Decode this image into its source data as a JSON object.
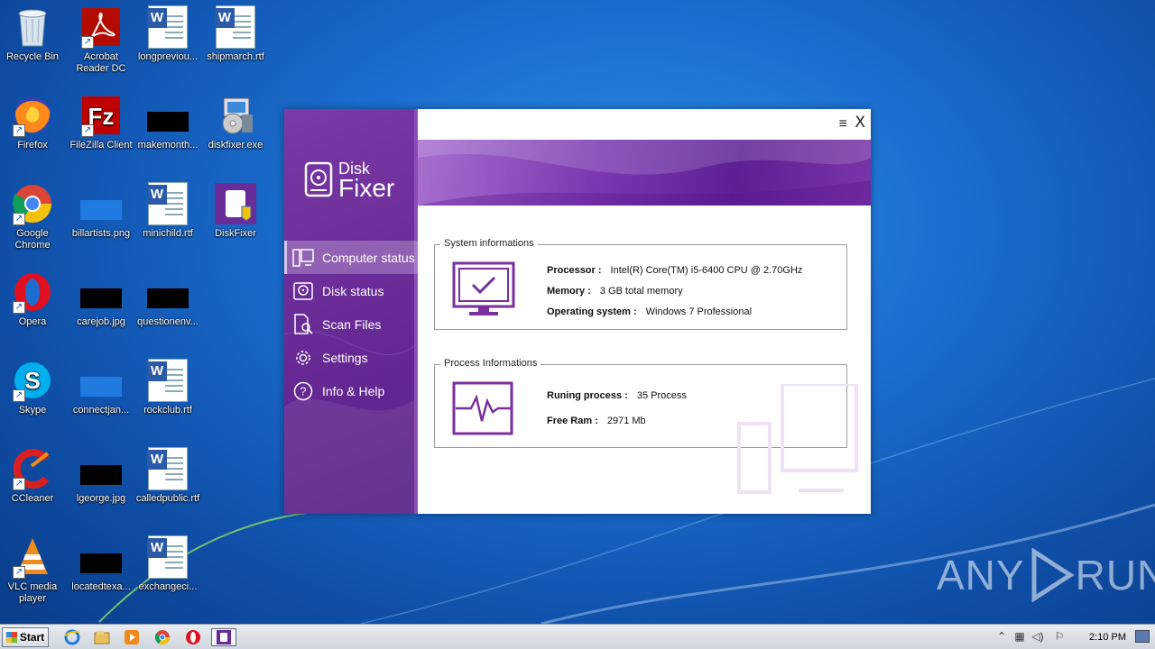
{
  "desktop": {
    "icons": [
      {
        "label": "Recycle Bin",
        "icon": "recycle-bin-icon"
      },
      {
        "label": "Acrobat Reader DC",
        "icon": "acrobat-icon"
      },
      {
        "label": "longpreviou...",
        "icon": "word-doc-icon"
      },
      {
        "label": "shipmarch.rtf",
        "icon": "word-doc-icon"
      },
      {
        "label": "Firefox",
        "icon": "firefox-icon"
      },
      {
        "label": "FileZilla Client",
        "icon": "filezilla-icon"
      },
      {
        "label": "makemonth...",
        "icon": "redacted-thumbnail-icon"
      },
      {
        "label": "diskfixer.exe",
        "icon": "installer-icon"
      },
      {
        "label": "Google Chrome",
        "icon": "chrome-icon"
      },
      {
        "label": "billartists.png",
        "icon": "image-thumbnail-icon"
      },
      {
        "label": "minichild.rtf",
        "icon": "word-doc-icon"
      },
      {
        "label": "DiskFixer",
        "icon": "diskfixer-icon"
      },
      {
        "label": "Opera",
        "icon": "opera-icon"
      },
      {
        "label": "carejob.jpg",
        "icon": "redacted-thumbnail-icon"
      },
      {
        "label": "questionenv...",
        "icon": "redacted-thumbnail-icon"
      },
      {
        "label": "Skype",
        "icon": "skype-icon"
      },
      {
        "label": "connectjan...",
        "icon": "image-thumbnail-icon"
      },
      {
        "label": "rockclub.rtf",
        "icon": "word-doc-icon"
      },
      {
        "label": "CCleaner",
        "icon": "ccleaner-icon"
      },
      {
        "label": "lgeorge.jpg",
        "icon": "redacted-thumbnail-icon"
      },
      {
        "label": "calledpublic.rtf",
        "icon": "word-doc-icon"
      },
      {
        "label": "VLC media player",
        "icon": "vlc-icon"
      },
      {
        "label": "locatedtexa...",
        "icon": "redacted-thumbnail-icon"
      },
      {
        "label": "exchangeci...",
        "icon": "word-doc-icon"
      }
    ]
  },
  "app": {
    "logo_line1": "Disk",
    "logo_line2": "Fixer",
    "nav": [
      {
        "label": "Computer status",
        "icon": "computer-status-icon",
        "active": true
      },
      {
        "label": "Disk status",
        "icon": "disk-icon",
        "active": false
      },
      {
        "label": "Scan Files",
        "icon": "scan-files-icon",
        "active": false
      },
      {
        "label": "Settings",
        "icon": "gear-icon",
        "active": false
      },
      {
        "label": "Info & Help",
        "icon": "help-icon",
        "active": false
      }
    ],
    "menu_glyph": "≡",
    "close_glyph": "X",
    "system": {
      "title": "System informations",
      "processor_label": "Processor :",
      "processor_value": "Intel(R) Core(TM) i5-6400 CPU @ 2.70GHz",
      "memory_label": "Memory :",
      "memory_value": "3 GB total memory",
      "os_label": "Operating system :",
      "os_value": "Windows 7 Professional"
    },
    "process": {
      "title": "Process Informations",
      "running_label": "Runing process :",
      "running_value": "35  Process",
      "ram_label": "Free Ram :",
      "ram_value": "2971  Mb"
    }
  },
  "taskbar": {
    "start_label": "Start",
    "clock": "2:10 PM",
    "pinned": [
      "ie-icon",
      "explorer-icon",
      "media-player-icon",
      "chrome-icon",
      "opera-icon",
      "diskfixer-icon"
    ]
  },
  "watermark": {
    "text_left": "ANY",
    "text_right": "RUN"
  },
  "colors": {
    "accent": "#6a2c98",
    "banner": "#7a38b0",
    "icon_purple": "#7a2f9e"
  }
}
